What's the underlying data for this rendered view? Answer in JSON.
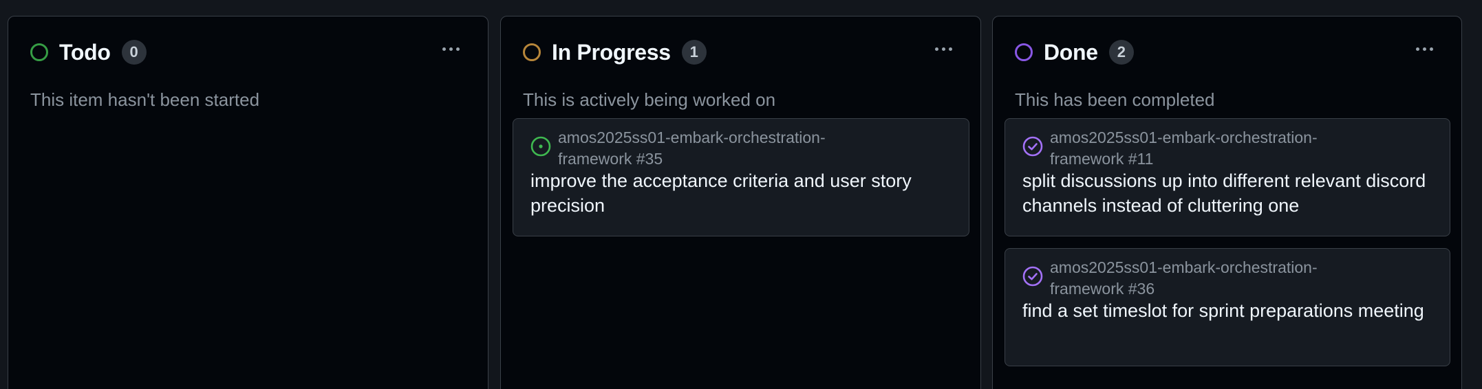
{
  "colors": {
    "todo": "#3fb950",
    "in_progress": "#d29922",
    "done": "#a371f7",
    "open_issue": "#3fb950",
    "closed_issue": "#a371f7"
  },
  "columns": [
    {
      "title": "Todo",
      "count": "0",
      "description": "This item hasn't been started",
      "status_icon": "circle-outline-icon",
      "cards": []
    },
    {
      "title": "In Progress",
      "count": "1",
      "description": "This is actively being worked on",
      "status_icon": "circle-outline-icon",
      "cards": [
        {
          "icon": "issue-open-icon",
          "repo": "amos2025ss01-embark-orchestration-framework #35",
          "title": "improve the acceptance criteria and user story precision"
        }
      ]
    },
    {
      "title": "Done",
      "count": "2",
      "description": "This has been completed",
      "status_icon": "circle-outline-icon",
      "cards": [
        {
          "icon": "issue-closed-icon",
          "repo": "amos2025ss01-embark-orchestration-framework #11",
          "title": "split discussions up into different relevant discord channels instead of cluttering one"
        },
        {
          "icon": "issue-closed-icon",
          "repo": "amos2025ss01-embark-orchestration-framework #36",
          "title": "find a set timeslot for sprint preparations meeting"
        }
      ]
    }
  ]
}
